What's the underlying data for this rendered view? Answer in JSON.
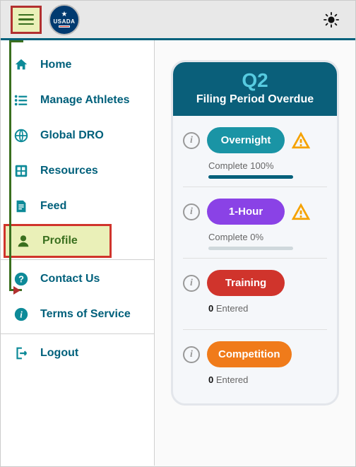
{
  "header": {
    "logo_label": "USADA"
  },
  "sidebar": {
    "home": "Home",
    "manage": "Manage Athletes",
    "dro": "Global DRO",
    "resources": "Resources",
    "feed": "Feed",
    "profile": "Profile",
    "contact": "Contact Us",
    "tos": "Terms of Service",
    "logout": "Logout"
  },
  "card": {
    "quarter": "Q2",
    "subtitle": "Filing Period Overdue",
    "items": {
      "overnight": {
        "label": "Overnight",
        "complete_word": "Complete",
        "percent_text": "100%",
        "percent": 100,
        "warning": true
      },
      "onehour": {
        "label": "1-Hour",
        "complete_word": "Complete",
        "percent_text": "0%",
        "percent": 0,
        "warning": true
      },
      "training": {
        "label": "Training",
        "count": "0",
        "entered_word": "Entered"
      },
      "competition": {
        "label": "Competition",
        "count": "0",
        "entered_word": "Entered"
      }
    }
  }
}
